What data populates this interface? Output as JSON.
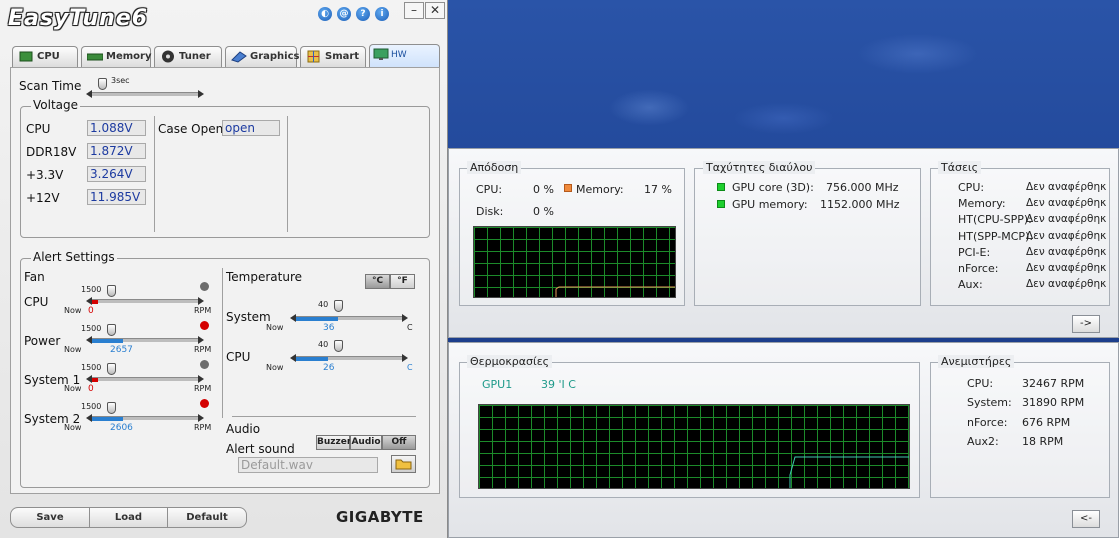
{
  "app": {
    "logo_text": "EasyTune6",
    "brand": "GIGABYTE"
  },
  "tabs": [
    {
      "label": "CPU"
    },
    {
      "label": "Memory"
    },
    {
      "label": "Tuner"
    },
    {
      "label": "Graphics"
    },
    {
      "label": "Smart"
    },
    {
      "label": "HW Monitor",
      "active": true
    }
  ],
  "scan": {
    "label": "Scan Time",
    "value": "3sec"
  },
  "voltage": {
    "title": "Voltage",
    "rows": [
      {
        "label": "CPU",
        "value": "1.088V"
      },
      {
        "label": "DDR18V",
        "value": "1.872V"
      },
      {
        "label": "+3.3V",
        "value": "3.264V"
      },
      {
        "label": "+12V",
        "value": "11.985V"
      }
    ],
    "case_open_label": "Case Open",
    "case_open_value": "open"
  },
  "alert": {
    "title": "Alert Settings",
    "fan_label": "Fan",
    "temp_label": "Temperature",
    "unit_c": "°C",
    "unit_f": "°F",
    "now_label": "Now",
    "rpm_label": "RPM",
    "c_label": "C",
    "fans": [
      {
        "label": "CPU",
        "threshold": "1500",
        "now": "0",
        "level": 0.06
      },
      {
        "label": "Power",
        "threshold": "1500",
        "now": "2657",
        "level": 0.29
      },
      {
        "label": "System 1",
        "threshold": "1500",
        "now": "0",
        "level": 0.06
      },
      {
        "label": "System 2",
        "threshold": "1500",
        "now": "2606",
        "level": 0.29
      }
    ],
    "temps": [
      {
        "label": "System",
        "threshold": "40",
        "now": "36",
        "level": 0.4
      },
      {
        "label": "CPU",
        "threshold": "40",
        "now": "26",
        "level": 0.3
      }
    ],
    "audio_label": "Audio",
    "alert_sound_label": "Alert sound",
    "buzzer": "Buzzer",
    "audio_btn": "Audio",
    "off": "Off",
    "sound_file": "Default.wav"
  },
  "footer": {
    "save": "Save",
    "load": "Load",
    "default": "Default"
  },
  "hw": {
    "perf": {
      "title": "Απόδοση",
      "cpu_label": "CPU:",
      "cpu_value": "0 %",
      "mem_label": "Memory:",
      "mem_value": "17 %",
      "disk_label": "Disk:",
      "disk_value": "0 %"
    },
    "bus": {
      "title": "Ταχύτητες διαύλου",
      "rows": [
        {
          "label": "GPU core (3D):",
          "value": "756.000 MHz"
        },
        {
          "label": "GPU memory:",
          "value": "1152.000 MHz"
        }
      ]
    },
    "voltages": {
      "title": "Τάσεις",
      "rows": [
        {
          "label": "CPU:",
          "value": "Δεν αναφέρθηκε"
        },
        {
          "label": "Memory:",
          "value": "Δεν αναφέρθηκε"
        },
        {
          "label": "HT(CPU-SPP):",
          "value": "Δεν αναφέρθηκε"
        },
        {
          "label": "HT(SPP-MCP):",
          "value": "Δεν αναφέρθηκε"
        },
        {
          "label": "PCI-E:",
          "value": "Δεν αναφέρθηκε"
        },
        {
          "label": "nForce:",
          "value": "Δεν αναφέρθηκε"
        },
        {
          "label": "Aux:",
          "value": "Δεν αναφέρθηκε"
        }
      ]
    },
    "next_btn": "->",
    "temps": {
      "title": "Θερμοκρασίες",
      "gpu_label": "GPU1",
      "gpu_value": "39 'I C"
    },
    "fans": {
      "title": "Ανεμιστήρες",
      "rows": [
        {
          "label": "CPU:",
          "value": "32467 RPM"
        },
        {
          "label": "System:",
          "value": "31890 RPM"
        },
        {
          "label": "nForce:",
          "value": "676 RPM"
        },
        {
          "label": "Aux2:",
          "value": "18 RPM"
        }
      ]
    },
    "prev_btn": "<-"
  },
  "colors": {
    "accent": "#2a7fd0",
    "alert_red": "#d40000",
    "graph_line_perf": "#e89a5a",
    "graph_line_temp": "#3fc9b0"
  }
}
